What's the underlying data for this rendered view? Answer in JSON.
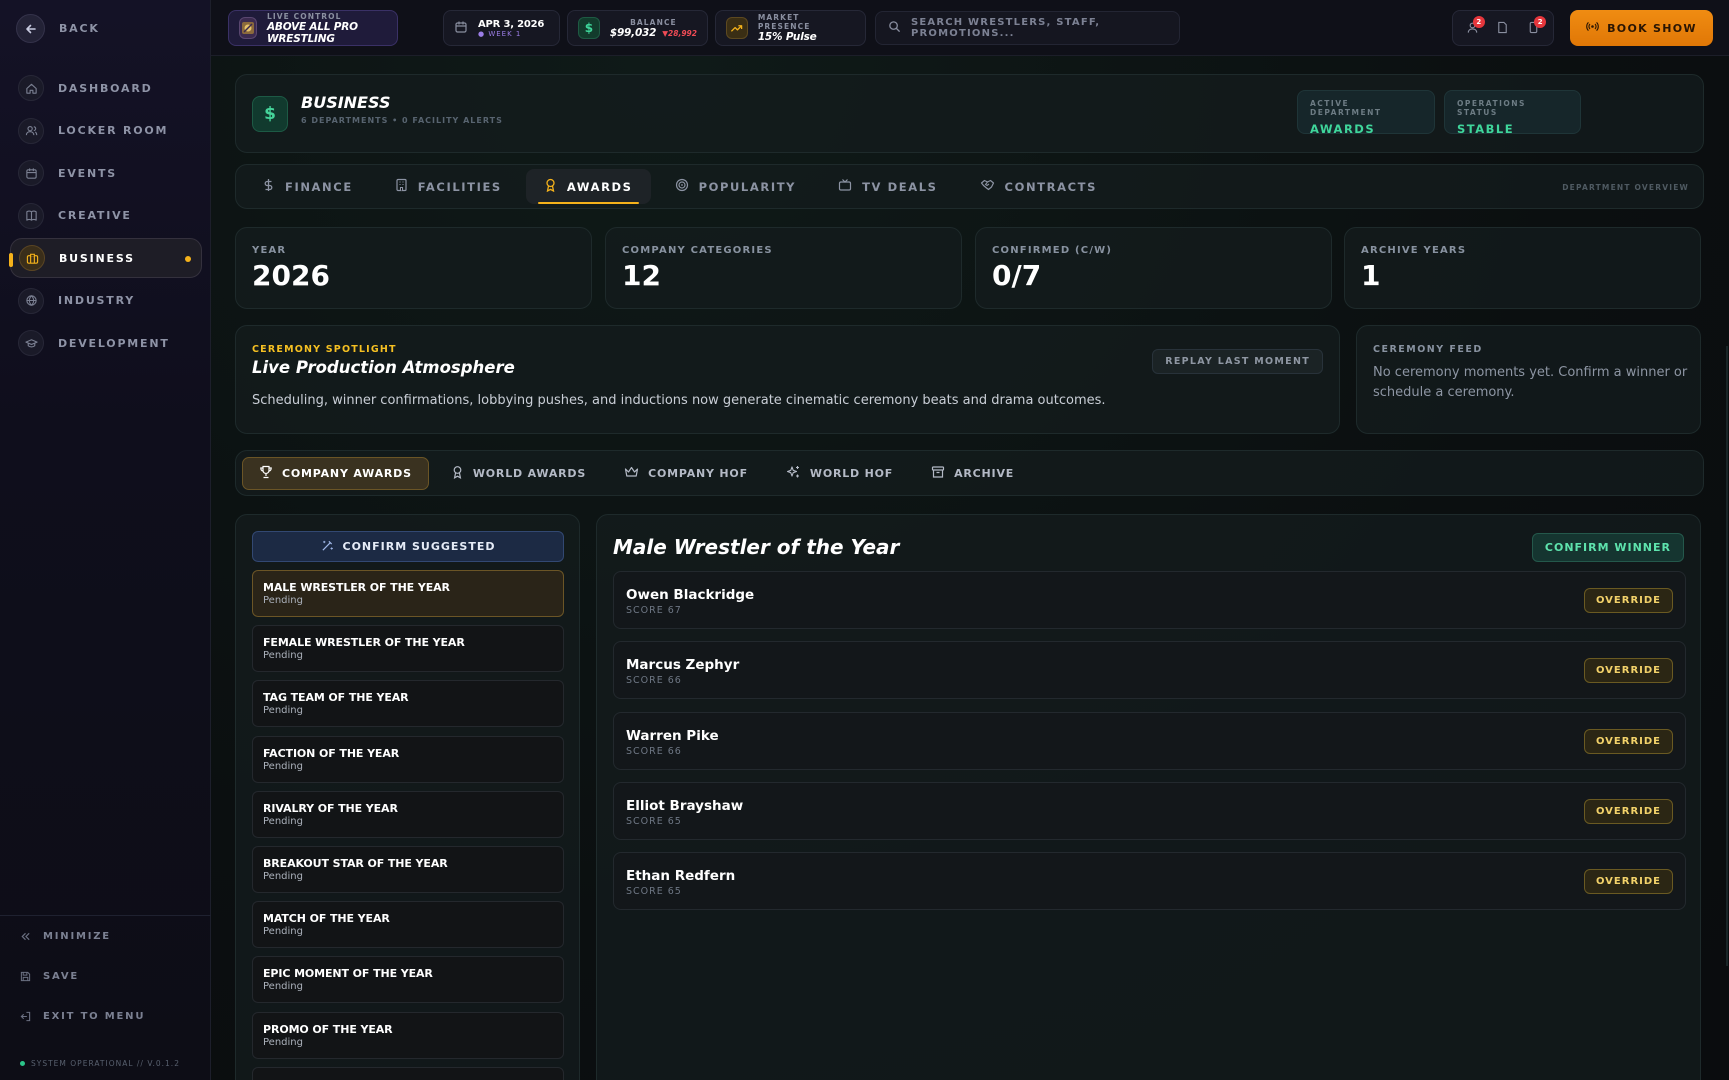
{
  "sidebar": {
    "back_label": "BACK",
    "items": [
      {
        "label": "DASHBOARD",
        "icon": "home-icon"
      },
      {
        "label": "LOCKER ROOM",
        "icon": "users-icon"
      },
      {
        "label": "EVENTS",
        "icon": "calendar-icon"
      },
      {
        "label": "CREATIVE",
        "icon": "book-icon"
      },
      {
        "label": "BUSINESS",
        "icon": "briefcase-icon",
        "active": true
      },
      {
        "label": "INDUSTRY",
        "icon": "globe-icon"
      },
      {
        "label": "DEVELOPMENT",
        "icon": "graduation-cap-icon"
      }
    ],
    "minimize_label": "MINIMIZE",
    "save_label": "SAVE",
    "exit_label": "EXIT TO MENU",
    "system_status": "SYSTEM OPERATIONAL // V.0.1.2"
  },
  "topbar": {
    "live_control_label": "LIVE CONTROL",
    "promotion_name": "ABOVE ALL PRO WRESTLING",
    "date": "APR 3, 2026",
    "week": "● WEEK 1",
    "balance_label": "BALANCE",
    "balance_value": "$99,032",
    "balance_change": "▼28,992",
    "market_label": "MARKET PRESENCE",
    "market_value": "15% Pulse",
    "search_placeholder": "SEARCH WRESTLERS, STAFF, PROMOTIONS...",
    "badge_1": "2",
    "badge_2": "2",
    "book_show_label": "BOOK SHOW"
  },
  "business": {
    "title": "BUSINESS",
    "subtitle": "6 DEPARTMENTS • 0 FACILITY ALERTS",
    "active_department_label": "ACTIVE DEPARTMENT",
    "active_department_value": "AWARDS",
    "operations_status_label": "OPERATIONS STATUS",
    "operations_status_value": "STABLE"
  },
  "department_tabs": [
    {
      "label": "FINANCE",
      "icon": "dollar-icon"
    },
    {
      "label": "FACILITIES",
      "icon": "building-icon"
    },
    {
      "label": "AWARDS",
      "icon": "award-icon",
      "active": true
    },
    {
      "label": "POPULARITY",
      "icon": "target-icon"
    },
    {
      "label": "TV DEALS",
      "icon": "tv-icon"
    },
    {
      "label": "CONTRACTS",
      "icon": "handshake-icon"
    }
  ],
  "department_overview_label": "DEPARTMENT OVERVIEW",
  "stats": [
    {
      "label": "YEAR",
      "value": "2026"
    },
    {
      "label": "COMPANY CATEGORIES",
      "value": "12"
    },
    {
      "label": "CONFIRMED (C/W)",
      "value": "0/7"
    },
    {
      "label": "ARCHIVE YEARS",
      "value": "1"
    }
  ],
  "spotlight": {
    "tag": "CEREMONY SPOTLIGHT",
    "title": "Live Production Atmosphere",
    "description": "Scheduling, winner confirmations, lobbying pushes, and inductions now generate cinematic ceremony beats and drama outcomes.",
    "replay_label": "REPLAY LAST MOMENT"
  },
  "feed": {
    "label": "CEREMONY FEED",
    "text": "No ceremony moments yet. Confirm a winner or schedule a ceremony."
  },
  "award_tabs": [
    {
      "label": "COMPANY AWARDS",
      "icon": "trophy-icon",
      "active": true
    },
    {
      "label": "WORLD AWARDS",
      "icon": "award-icon"
    },
    {
      "label": "COMPANY HOF",
      "icon": "crown-icon"
    },
    {
      "label": "WORLD HOF",
      "icon": "sparkles-icon"
    },
    {
      "label": "ARCHIVE",
      "icon": "archive-icon"
    }
  ],
  "confirm_suggested_label": "CONFIRM SUGGESTED",
  "categories": [
    {
      "name": "MALE WRESTLER OF THE YEAR",
      "status": "Pending",
      "active": true
    },
    {
      "name": "FEMALE WRESTLER OF THE YEAR",
      "status": "Pending"
    },
    {
      "name": "TAG TEAM OF THE YEAR",
      "status": "Pending"
    },
    {
      "name": "FACTION OF THE YEAR",
      "status": "Pending"
    },
    {
      "name": "RIVALRY OF THE YEAR",
      "status": "Pending"
    },
    {
      "name": "BREAKOUT STAR OF THE YEAR",
      "status": "Pending"
    },
    {
      "name": "MATCH OF THE YEAR",
      "status": "Pending"
    },
    {
      "name": "EPIC MOMENT OF THE YEAR",
      "status": "Pending"
    },
    {
      "name": "PROMO OF THE YEAR",
      "status": "Pending"
    }
  ],
  "nominees_panel": {
    "title": "Male Wrestler of the Year",
    "confirm_winner_label": "CONFIRM WINNER",
    "override_label": "OVERRIDE",
    "nominees": [
      {
        "name": "Owen Blackridge",
        "score": "SCORE 67"
      },
      {
        "name": "Marcus Zephyr",
        "score": "SCORE 66"
      },
      {
        "name": "Warren Pike",
        "score": "SCORE 66"
      },
      {
        "name": "Elliot Brayshaw",
        "score": "SCORE 65"
      },
      {
        "name": "Ethan Redfern",
        "score": "SCORE 65"
      }
    ]
  },
  "colors": {
    "accent": "#f5b21b",
    "success": "#3fd69b",
    "orange": "#f08c12"
  }
}
